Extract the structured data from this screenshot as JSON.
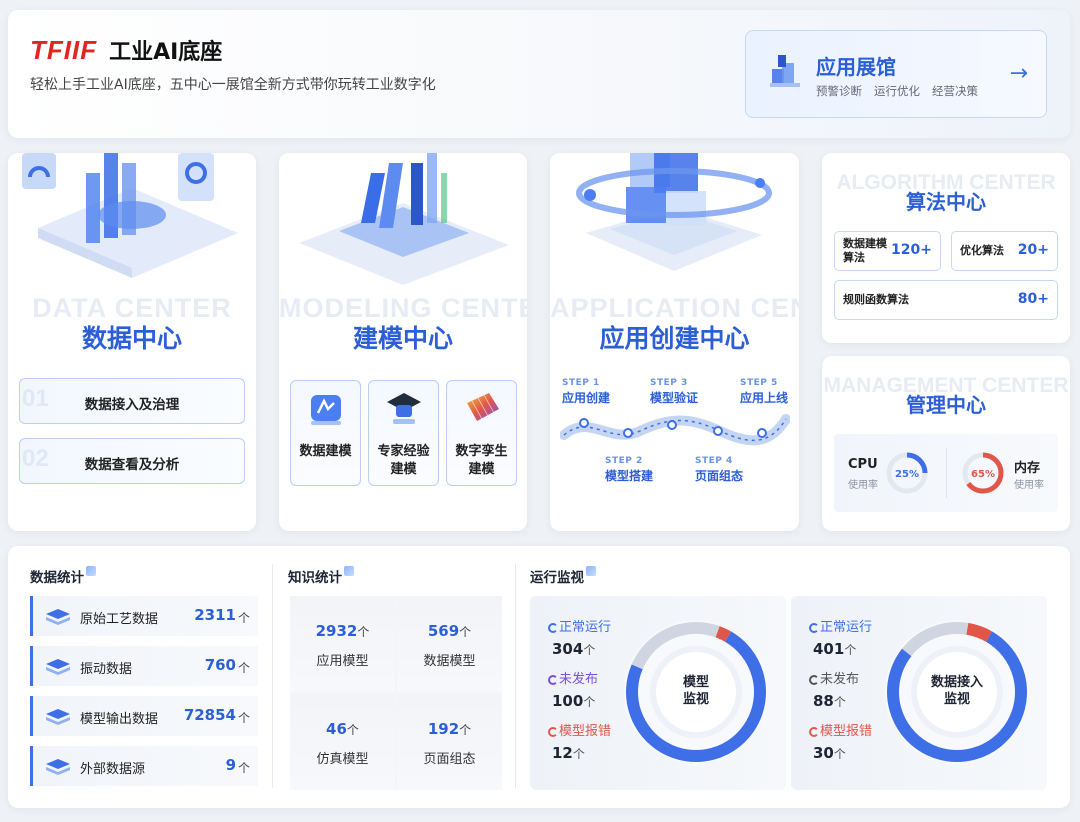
{
  "header": {
    "logo": "TFIIF",
    "title": "工业AI底座",
    "subtitle": "轻松上手工业AI底座，五中心一展馆全新方式带你玩转工业数字化"
  },
  "hall": {
    "title": "应用展馆",
    "tags": [
      "预警诊断",
      "运行优化",
      "经营决策"
    ],
    "arrow": "→"
  },
  "data_center": {
    "ghost": "DATA CENTER",
    "title": "数据中心",
    "items": [
      {
        "num": "01",
        "label": "数据接入及治理"
      },
      {
        "num": "02",
        "label": "数据查看及分析"
      }
    ]
  },
  "modeling_center": {
    "ghost": "MODELING CENTER",
    "title": "建模中心",
    "tiles": [
      {
        "line1": "数据建模",
        "line2": ""
      },
      {
        "line1": "专家经验",
        "line2": "建模"
      },
      {
        "line1": "数字孪生",
        "line2": "建模"
      }
    ]
  },
  "app_center": {
    "ghost": "APPLICATION CENTER",
    "title": "应用创建中心",
    "steps": [
      {
        "key": "STEP 1",
        "label": "应用创建"
      },
      {
        "key": "STEP 2",
        "label": "模型搭建"
      },
      {
        "key": "STEP 3",
        "label": "模型验证"
      },
      {
        "key": "STEP 4",
        "label": "页面组态"
      },
      {
        "key": "STEP 5",
        "label": "应用上线"
      }
    ]
  },
  "algo_center": {
    "ghost": "ALGORITHM CENTER",
    "title": "算法中心",
    "items": [
      {
        "label1": "数据建模",
        "label2": "算法",
        "value": "120+"
      },
      {
        "label1": "优化算法",
        "label2": "",
        "value": "20+"
      },
      {
        "label1": "规则函数算法",
        "label2": "",
        "value": "80+"
      }
    ]
  },
  "mgmt_center": {
    "ghost": "MANAGEMENT CENTER",
    "title": "管理中心",
    "cpu": {
      "name": "CPU",
      "sub": "使用率",
      "value": "25%",
      "fraction": 0.25,
      "color": "#3e6fe6"
    },
    "mem": {
      "name": "内存",
      "sub": "使用率",
      "value": "65%",
      "fraction": 0.65,
      "color": "#e0574a"
    }
  },
  "data_stats": {
    "title": "数据统计",
    "unit": "个",
    "rows": [
      {
        "label": "原始工艺数据",
        "value": "2311"
      },
      {
        "label": "振动数据",
        "value": "760"
      },
      {
        "label": "模型输出数据",
        "value": "72854"
      },
      {
        "label": "外部数据源",
        "value": "9"
      }
    ]
  },
  "knowledge_stats": {
    "title": "知识统计",
    "unit": "个",
    "cells": [
      {
        "value": "2932",
        "label": "应用模型"
      },
      {
        "value": "569",
        "label": "数据模型"
      },
      {
        "value": "46",
        "label": "仿真模型"
      },
      {
        "value": "192",
        "label": "页面组态"
      }
    ]
  },
  "monitor": {
    "title": "运行监视",
    "unit": "个",
    "panels": [
      {
        "center_line1": "模型",
        "center_line2": "监视",
        "rows": [
          {
            "label": "正常运行",
            "value": "304",
            "color": "#3e6fe6"
          },
          {
            "label": "未发布",
            "value": "100",
            "color": "#7a4fe0"
          },
          {
            "label": "模型报错",
            "value": "12",
            "color": "#e0574a"
          }
        ]
      },
      {
        "center_line1": "数据接入",
        "center_line2": "监视",
        "rows": [
          {
            "label": "正常运行",
            "value": "401",
            "color": "#3e6fe6"
          },
          {
            "label": "未发布",
            "value": "88",
            "color": "#555555"
          },
          {
            "label": "模型报错",
            "value": "30",
            "color": "#e0574a"
          }
        ]
      }
    ]
  }
}
